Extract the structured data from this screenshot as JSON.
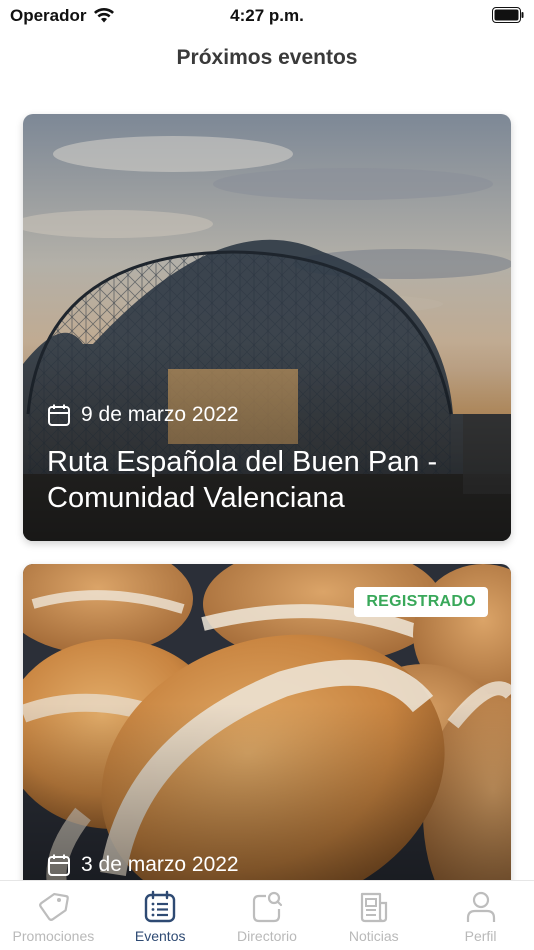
{
  "status_bar": {
    "carrier": "Operador",
    "time": "4:27 p.m."
  },
  "header": {
    "title": "Próximos eventos"
  },
  "events": [
    {
      "date": "9 de marzo 2022",
      "title": "Ruta Española del Buen Pan - Comunidad Valenciana",
      "image": "glass-arch-station-sunset"
    },
    {
      "date": "3 de marzo 2022",
      "title": "",
      "badge": "REGISTRADO",
      "image": "rustic-bread-loaves"
    }
  ],
  "tab_bar": {
    "items": [
      {
        "label": "Promociones",
        "icon": "tag-icon",
        "active": false
      },
      {
        "label": "Eventos",
        "icon": "calendar-list-icon",
        "active": true
      },
      {
        "label": "Directorio",
        "icon": "directory-icon",
        "active": false
      },
      {
        "label": "Noticias",
        "icon": "newspaper-icon",
        "active": false
      },
      {
        "label": "Perfil",
        "icon": "user-icon",
        "active": false
      }
    ]
  },
  "colors": {
    "active_tab": "#2e4a73",
    "inactive_tab": "#b9b9b9",
    "badge_text": "#39a85a"
  }
}
